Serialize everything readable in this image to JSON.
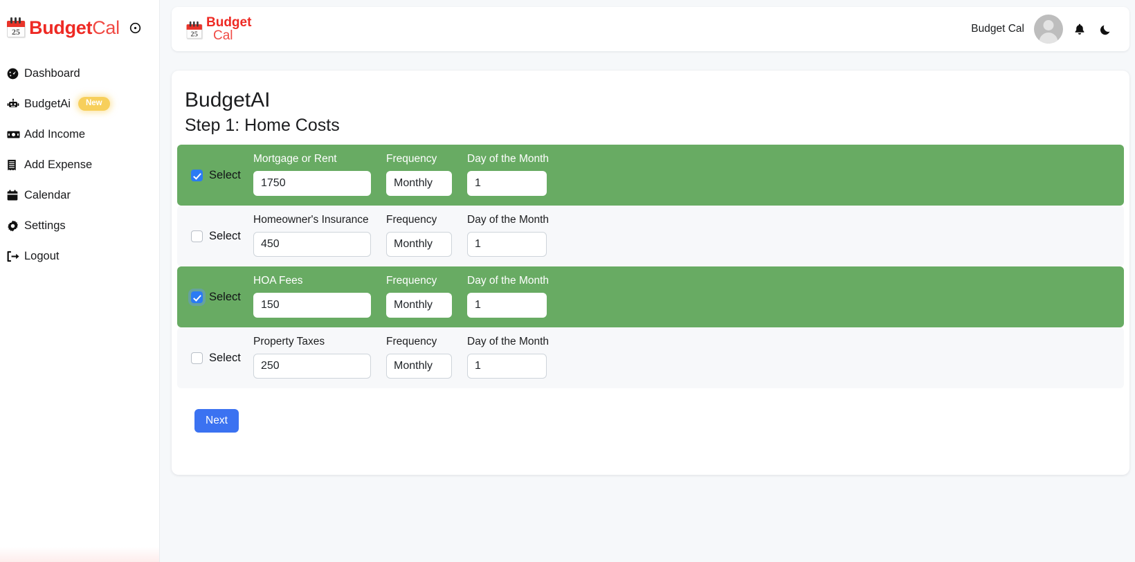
{
  "brand": {
    "name_bold": "Budget",
    "name_light": "Cal",
    "calendar_day": "25",
    "toggle_icon": "circle-dot-icon",
    "accent_red": "#ee2a24"
  },
  "sidebar": {
    "items": [
      {
        "label": "Dashboard",
        "icon": "gauge-icon",
        "badge": ""
      },
      {
        "label": "BudgetAi",
        "icon": "robot-icon",
        "badge": "New"
      },
      {
        "label": "Add Income",
        "icon": "money-bill-icon",
        "badge": ""
      },
      {
        "label": "Add Expense",
        "icon": "receipt-icon",
        "badge": ""
      },
      {
        "label": "Calendar",
        "icon": "calendar-icon",
        "badge": ""
      },
      {
        "label": "Settings",
        "icon": "gear-icon",
        "badge": ""
      },
      {
        "label": "Logout",
        "icon": "logout-icon",
        "badge": ""
      }
    ],
    "badge_color": "#f7cf5b"
  },
  "topbar": {
    "logo_bold": "Budget",
    "logo_light": "Cal",
    "username": "Budget Cal",
    "avatar_name": "user-avatar",
    "notification_icon": "bell-icon",
    "theme_icon": "moon-icon"
  },
  "main": {
    "title": "BudgetAI",
    "subtitle": "Step 1: Home Costs",
    "select_label": "Select",
    "frequency_label": "Frequency",
    "day_label": "Day of the Month",
    "next_button": "Next",
    "selected_row_color": "#68ab63",
    "unselected_row_color": "#f7f8fa",
    "next_button_color": "#3b72f1",
    "checkbox_color": "#2b7bf3",
    "rows": [
      {
        "name": "Mortgage or Rent",
        "amount": "1750",
        "frequency": "Monthly",
        "day": "1",
        "selected": true,
        "focused": false
      },
      {
        "name": "Homeowner's Insurance",
        "amount": "450",
        "frequency": "Monthly",
        "day": "1",
        "selected": false,
        "focused": false
      },
      {
        "name": "HOA Fees",
        "amount": "150",
        "frequency": "Monthly",
        "day": "1",
        "selected": true,
        "focused": true
      },
      {
        "name": "Property Taxes",
        "amount": "250",
        "frequency": "Monthly",
        "day": "1",
        "selected": false,
        "focused": false
      }
    ]
  }
}
